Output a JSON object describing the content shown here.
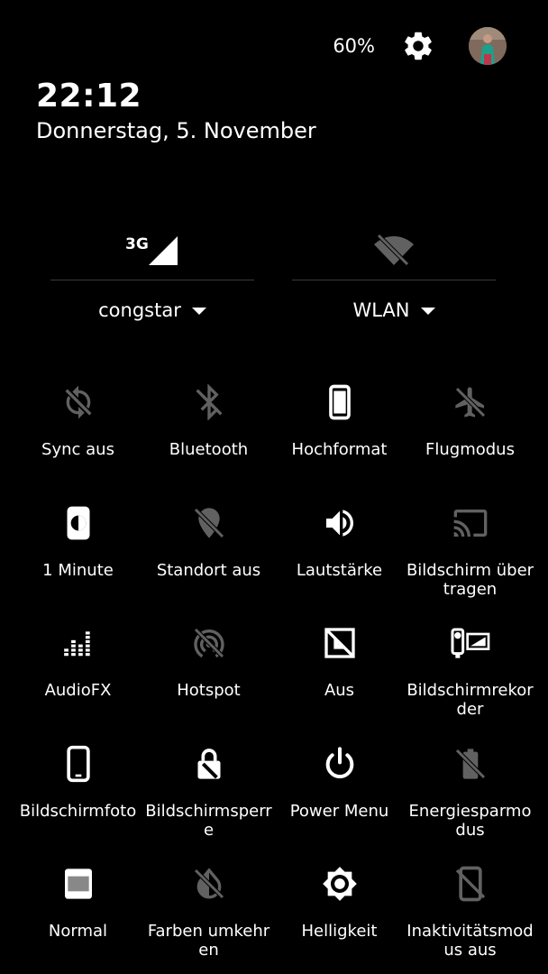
{
  "status": {
    "battery_percent": "60%",
    "settings_icon": "gear-icon",
    "avatar_icon": "user-avatar"
  },
  "header": {
    "time": "22:12",
    "date": "Donnerstag, 5. November"
  },
  "network": {
    "mobile": {
      "badge": "3G",
      "label": "congstar",
      "icon": "signal-icon"
    },
    "wifi": {
      "label": "WLAN",
      "icon": "wifi-off-icon"
    }
  },
  "tiles": [
    {
      "label": "Sync aus",
      "icon": "sync-off-icon",
      "active": false
    },
    {
      "label": "Bluetooth",
      "icon": "bluetooth-off-icon",
      "active": false
    },
    {
      "label": "Hochformat",
      "icon": "portrait-icon",
      "active": true
    },
    {
      "label": "Flugmodus",
      "icon": "airplane-off-icon",
      "active": false
    },
    {
      "label": "1 Minute",
      "icon": "screen-timeout-icon",
      "active": true
    },
    {
      "label": "Standort aus",
      "icon": "location-off-icon",
      "active": false
    },
    {
      "label": "Lautstärke",
      "icon": "volume-icon",
      "active": true
    },
    {
      "label": "Bildschirm übertragen",
      "icon": "cast-icon",
      "active": false
    },
    {
      "label": "AudioFX",
      "icon": "equalizer-icon",
      "active": true
    },
    {
      "label": "Hotspot",
      "icon": "hotspot-off-icon",
      "active": false
    },
    {
      "label": "Aus",
      "icon": "ambient-display-off-icon",
      "active": true
    },
    {
      "label": "Bildschirmrekorder",
      "icon": "screen-recorder-icon",
      "active": true
    },
    {
      "label": "Bildschirmfoto",
      "icon": "screenshot-icon",
      "active": true
    },
    {
      "label": "Bildschirmsperre",
      "icon": "lock-icon",
      "active": true
    },
    {
      "label": "Power Menu",
      "icon": "power-icon",
      "active": true
    },
    {
      "label": "Energiesparmodus",
      "icon": "battery-saver-off-icon",
      "active": false
    },
    {
      "label": "Normal",
      "icon": "display-mode-icon",
      "active": true
    },
    {
      "label": "Farben umkehren",
      "icon": "invert-colors-off-icon",
      "active": false
    },
    {
      "label": "Helligkeit",
      "icon": "brightness-icon",
      "active": true
    },
    {
      "label": "Inaktivitätsmodus aus",
      "icon": "inactivity-off-icon",
      "active": false
    }
  ]
}
